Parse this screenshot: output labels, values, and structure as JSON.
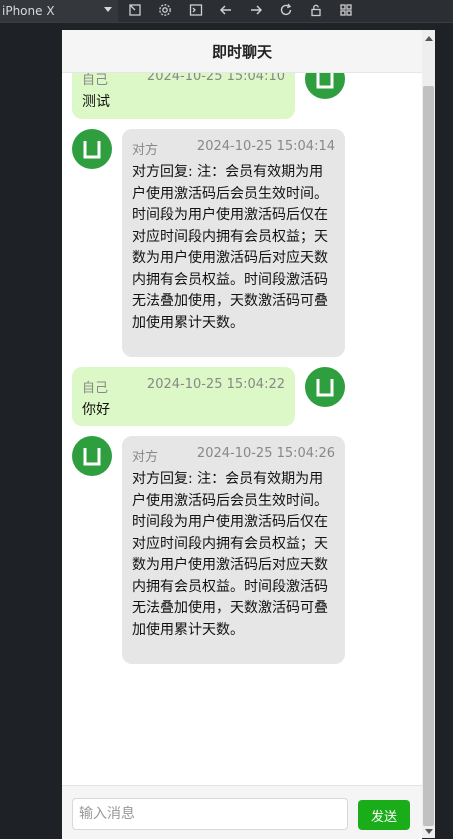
{
  "toolbar": {
    "device_label": "iPhone X",
    "icons": [
      "device-rotate-icon",
      "gear-icon",
      "console-icon",
      "arrow-left-icon",
      "arrow-right-icon",
      "refresh-icon",
      "lock-icon",
      "qr-code-icon"
    ]
  },
  "chat": {
    "title": "即时聊天",
    "messages": [
      {
        "sender": "自己",
        "time": "2024-10-25 15:04:10",
        "text": "测试",
        "self": true
      },
      {
        "sender": "对方",
        "time": "2024-10-25 15:04:14",
        "text": "对方回复: 注：会员有效期为用户使用激活码后会员生效时间。时间段为用户使用激活码后仅在对应时间段内拥有会员权益；天数为用户使用激活码后对应天数内拥有会员权益。时间段激活码无法叠加使用，天数激活码可叠加使用累计天数。",
        "self": false
      },
      {
        "sender": "自己",
        "time": "2024-10-25 15:04:22",
        "text": "你好",
        "self": true
      },
      {
        "sender": "对方",
        "time": "2024-10-25 15:04:26",
        "text": "对方回复: 注：会员有效期为用户使用激活码后会员生效时间。时间段为用户使用激活码后仅在对应时间段内拥有会员权益；天数为用户使用激活码后对应天数内拥有会员权益。时间段激活码无法叠加使用，天数激活码可叠加使用累计天数。",
        "self": false
      }
    ]
  },
  "input": {
    "placeholder": "输入消息",
    "value": "",
    "send_label": "发送"
  },
  "colors": {
    "self_bubble": "#dcf8c6",
    "other_bubble": "#e6e6e6",
    "avatar": "#2e9e3f",
    "send_button": "#1aad19"
  }
}
